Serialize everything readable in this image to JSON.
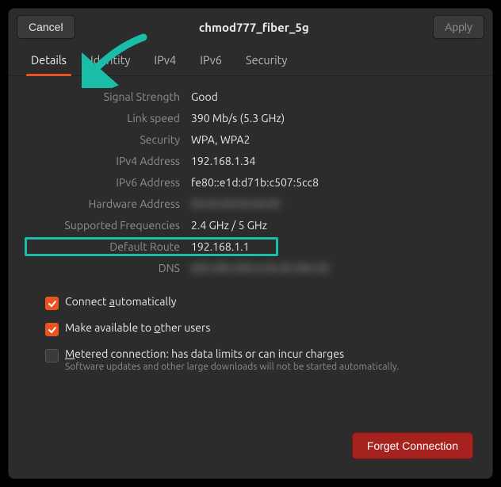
{
  "header": {
    "cancel": "Cancel",
    "title": "chmod777_fiber_5g",
    "apply": "Apply"
  },
  "tabs": {
    "details": "Details",
    "identity": "Identity",
    "ipv4": "IPv4",
    "ipv6": "IPv6",
    "security": "Security"
  },
  "details": {
    "signal_strength": {
      "label": "Signal Strength",
      "value": "Good"
    },
    "link_speed": {
      "label": "Link speed",
      "value": "390 Mb/s (5.3 GHz)"
    },
    "security": {
      "label": "Security",
      "value": "WPA, WPA2"
    },
    "ipv4": {
      "label": "IPv4 Address",
      "value": "192.168.1.34"
    },
    "ipv6": {
      "label": "IPv6 Address",
      "value": "fe80::e1d:d71b:c507:5cc8"
    },
    "hw": {
      "label": "Hardware Address",
      "value": "00:00:00:00:00:00"
    },
    "freq": {
      "label": "Supported Frequencies",
      "value": "2.4 GHz / 5 GHz"
    },
    "route": {
      "label": "Default Route",
      "value": "192.168.1.1"
    },
    "dns": {
      "label": "DNS",
      "value": "000.000.000.0  00.00.000.00"
    }
  },
  "options": {
    "auto": {
      "checked": true,
      "label_pre": "Connect ",
      "label_u": "a",
      "label_post": "utomatically"
    },
    "share": {
      "checked": true,
      "label_pre": "Make available to ",
      "label_u": "o",
      "label_post": "ther users"
    },
    "metered": {
      "checked": false,
      "label_pre": "",
      "label_u": "M",
      "label_post": "etered connection: has data limits or can incur charges",
      "sub": "Software updates and other large downloads will not be started automatically."
    }
  },
  "footer": {
    "forget": "Forget Connection"
  }
}
